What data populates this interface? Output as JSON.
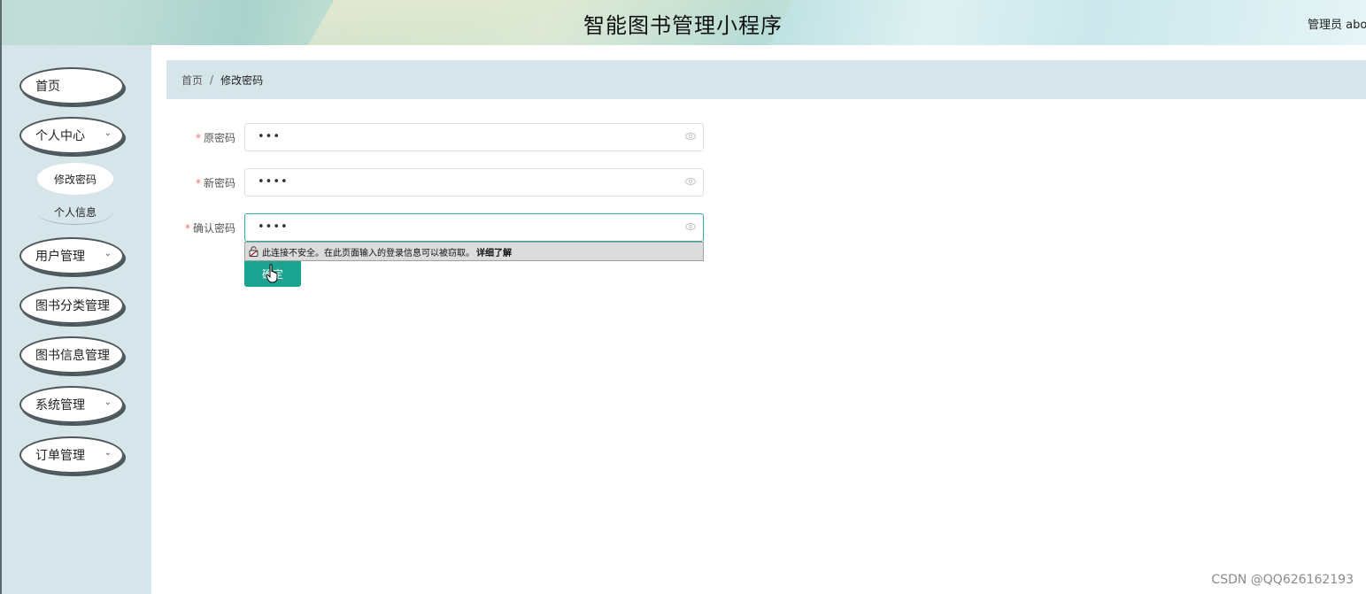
{
  "header": {
    "title": "智能图书管理小程序",
    "admin_label": "管理员 abo"
  },
  "sidebar": {
    "items": [
      {
        "label": "首页"
      },
      {
        "label": "个人中心"
      },
      {
        "label": "用户管理"
      },
      {
        "label": "图书分类管理"
      },
      {
        "label": "图书信息管理"
      },
      {
        "label": "系统管理"
      },
      {
        "label": "订单管理"
      }
    ],
    "subitems": [
      {
        "label": "修改密码"
      },
      {
        "label": "个人信息"
      }
    ]
  },
  "breadcrumb": {
    "home": "首页",
    "separator": "/",
    "current": "修改密码"
  },
  "form": {
    "required_mark": "*",
    "fields": [
      {
        "label": "原密码",
        "value": "•••"
      },
      {
        "label": "新密码",
        "value": "••••"
      },
      {
        "label": "确认密码",
        "value": "••••"
      }
    ],
    "submit_label": "确定"
  },
  "warning": {
    "text": "此连接不安全。在此页面输入的登录信息可以被窃取。",
    "link": "详细了解"
  },
  "watermark": "CSDN @QQ626162193",
  "colors": {
    "accent": "#1aa38f",
    "sidebar_bg": "#d6e5ea",
    "required": "#f56c6c"
  }
}
